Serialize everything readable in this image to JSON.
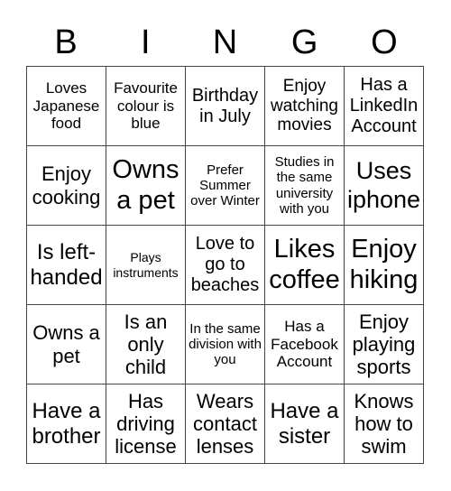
{
  "header": {
    "letters": [
      "B",
      "I",
      "N",
      "G",
      "O"
    ]
  },
  "board": {
    "rows": [
      [
        "Loves Japanese food",
        "Favourite colour is blue",
        "Birthday in July",
        "Enjoy watching movies",
        "Has a LinkedIn Account"
      ],
      [
        "Enjoy cooking",
        "Owns a pet",
        "Prefer Summer over Winter",
        "Studies in the same university with you",
        "Uses iphone"
      ],
      [
        "Is left-handed",
        "Plays instruments",
        "Love to go to beaches",
        "Likes coffee",
        "Enjoy hiking"
      ],
      [
        "Owns a pet",
        "Is an only child",
        "In the same division with you",
        "Has a Facebook Account",
        "Enjoy playing sports"
      ],
      [
        "Have a brother",
        "Has driving license",
        "Wears contact lenses",
        "Have a sister",
        "Knows how to swim"
      ]
    ]
  }
}
